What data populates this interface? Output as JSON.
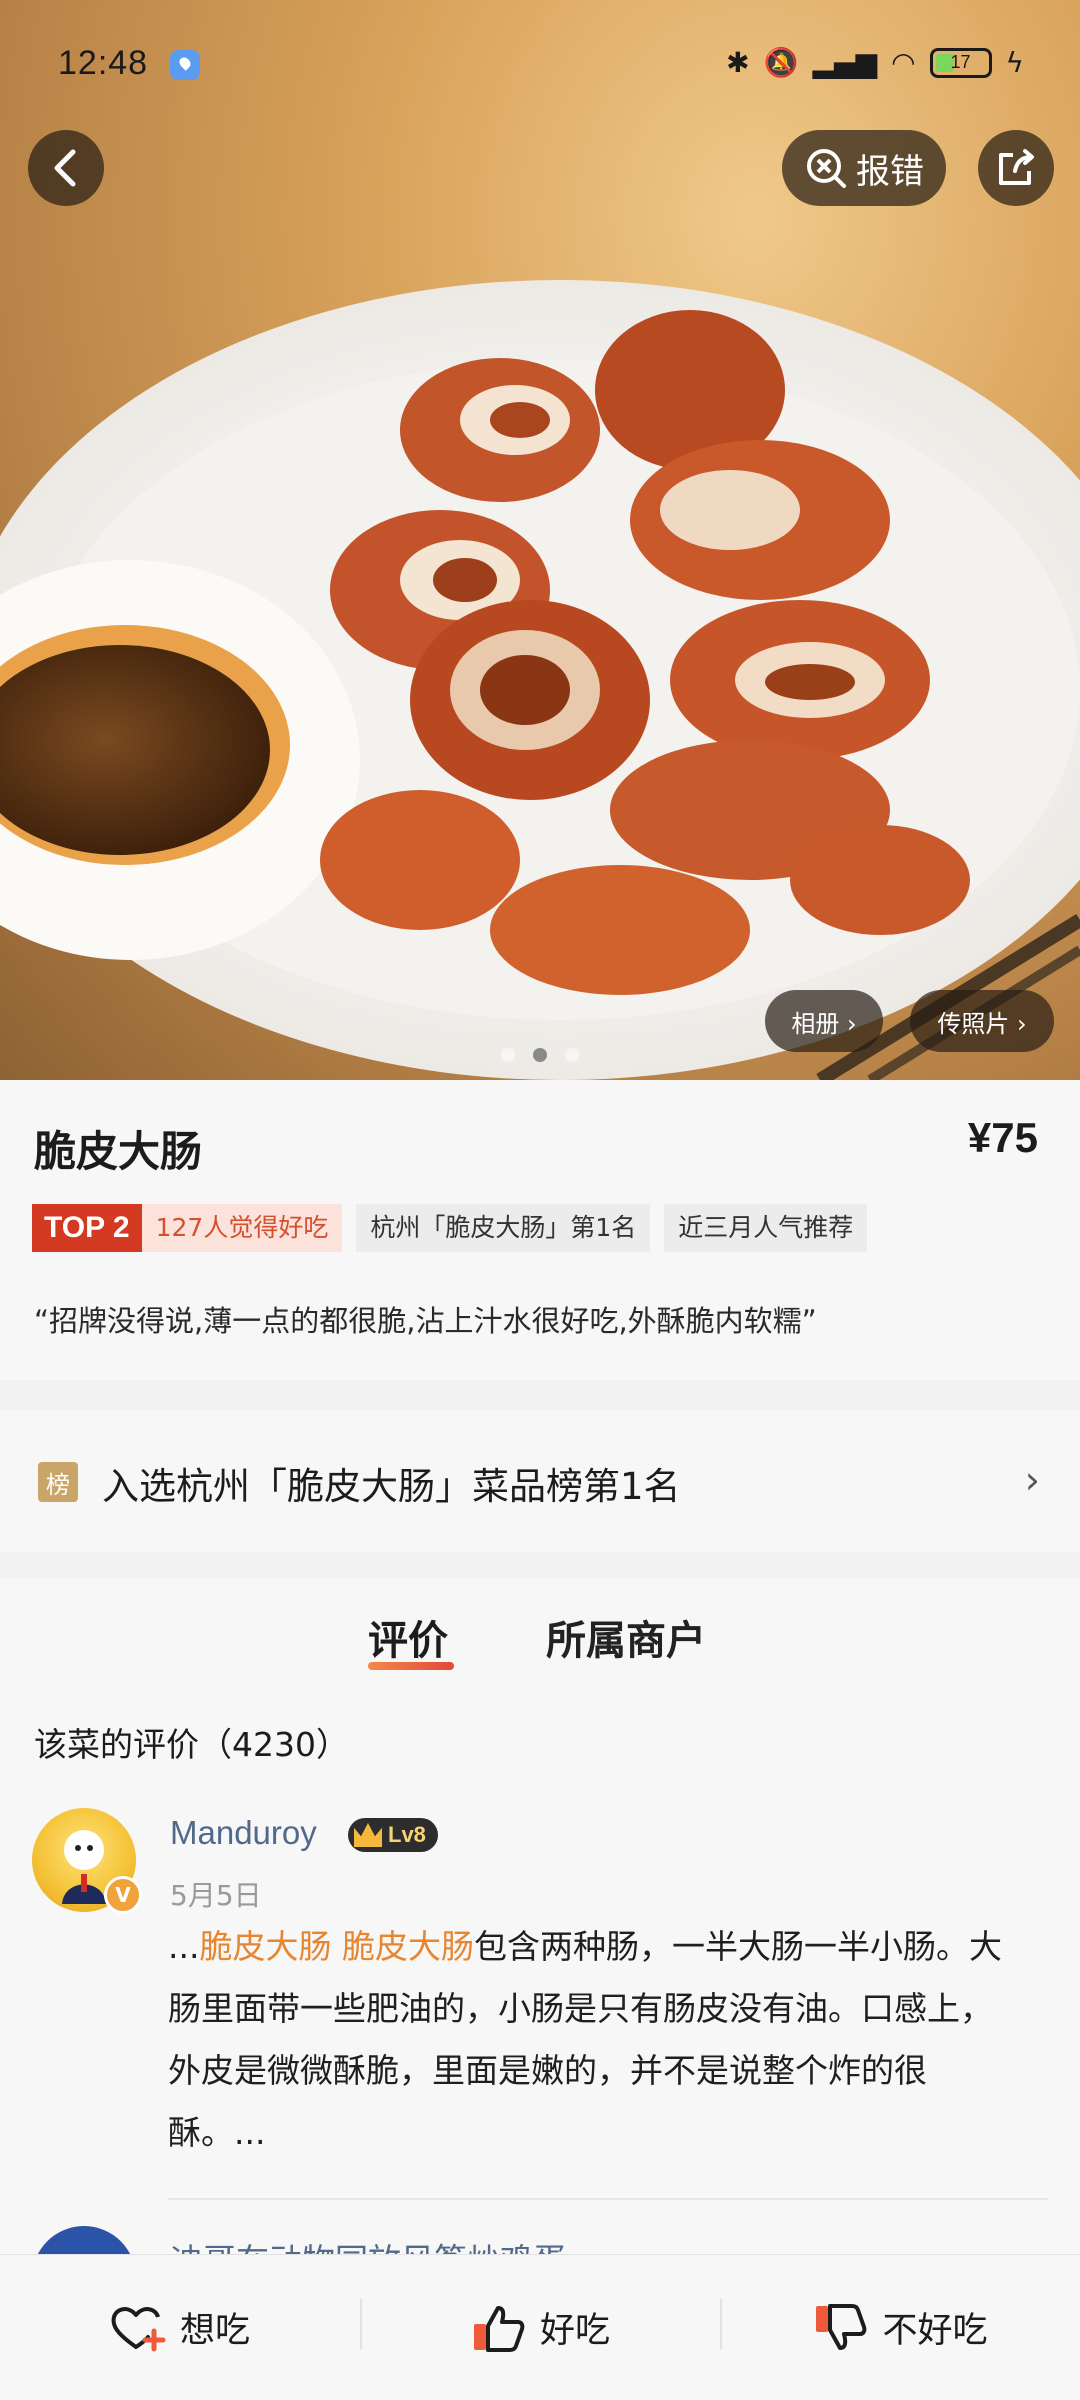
{
  "status_bar": {
    "time": "12:48",
    "battery": "17"
  },
  "hero": {
    "report_label": "报错",
    "album_label": "相册 ›",
    "upload_label": "传照片 ›",
    "photo_count": 3,
    "active_photo": 2
  },
  "dish": {
    "title": "脆皮大肠",
    "price": "¥75",
    "top_rank": "TOP 2",
    "liked_count": "127人觉得好吃",
    "tags": [
      "杭州「脆皮大肠」第1名",
      "近三月人气推荐"
    ],
    "quote": "“招牌没得说,薄一点的都很脆,沾上汁水很好吃,外酥脆内软糯”"
  },
  "ranking": {
    "badge": "榜",
    "text": "入选杭州「脆皮大肠」菜品榜第1名"
  },
  "reviews": {
    "tabs": [
      "评价",
      "所属商户"
    ],
    "count_label": "该菜的评价（4230）",
    "items": [
      {
        "user": "Manduroy",
        "level": "Lv8",
        "badge": "V",
        "date": "5月5日",
        "prefix": "...",
        "highlight": "脆皮大肠 脆皮大肠",
        "text": "包含两种肠，一半大肠一半小肠。大肠里面带一些肥油的，小肠是只有肠皮没有油。口感上，外皮是微微酥脆，里面是嫩的，并不是说整个炸的很酥。..."
      },
      {
        "user": "迪哥在动物园放风筝炒鸡蛋"
      }
    ]
  },
  "bottom_bar": {
    "want": "想吃",
    "good": "好吃",
    "bad": "不好吃"
  },
  "colors": {
    "accent": "#e4473a",
    "highlight": "#e8852f",
    "username": "#516a8a"
  }
}
